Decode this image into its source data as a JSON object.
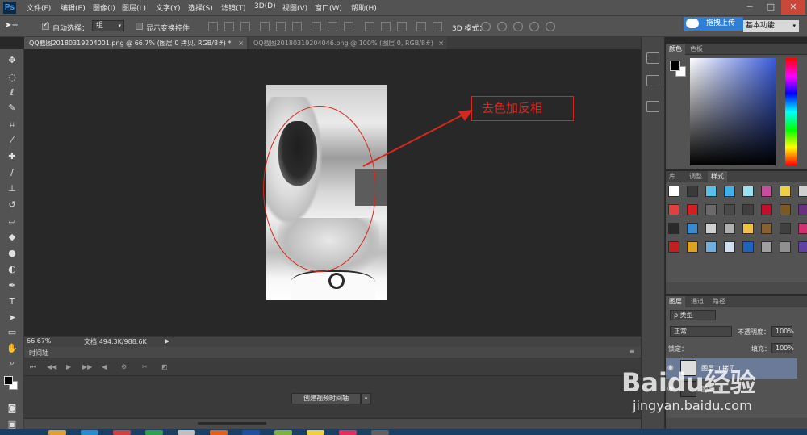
{
  "app": {
    "logo": "Ps"
  },
  "menu": [
    "文件(F)",
    "编辑(E)",
    "图像(I)",
    "图层(L)",
    "文字(Y)",
    "选择(S)",
    "滤镜(T)",
    "3D(D)",
    "视图(V)",
    "窗口(W)",
    "帮助(H)"
  ],
  "window_controls": {
    "minimize": "─",
    "maximize": "□",
    "close": "✕"
  },
  "options_bar": {
    "auto_select_label": "自动选择：",
    "auto_select_value": "组",
    "show_transform_label": "显示变换控件",
    "mode_3d_label": "3D 模式：",
    "upload_label": "拖拽上传",
    "workspace": "基本功能"
  },
  "tabs": [
    {
      "title": "QQ截图20180319204001.png @ 66.7% (图层 0 拷贝, RGB/8#) *",
      "close": "×"
    },
    {
      "title": "QQ截图20180319204046.png @ 100% (图层 0, RGB/8#)",
      "close": "×"
    }
  ],
  "canvas": {
    "annotation": "去色加反相"
  },
  "status": {
    "zoom": "66.67%",
    "doc_info": "文档:494.3K/988.6K"
  },
  "timeline": {
    "title": "时间轴",
    "create_button": "创建视频时间轴"
  },
  "color_panel": {
    "tabs": [
      "颜色",
      "色板"
    ]
  },
  "styles_panel": {
    "tabs": [
      "库",
      "调整",
      "样式"
    ],
    "active": "样式"
  },
  "layers_panel": {
    "tabs": [
      "图层",
      "通道",
      "路径"
    ],
    "filter_kind": "ρ 类型",
    "blend_mode": "正常",
    "opacity_label": "不透明度：",
    "opacity_value": "100%",
    "lock_label": "锁定：",
    "fill_label": "填充：",
    "fill_value": "100%",
    "layers": [
      {
        "name": "图层 0 拷贝",
        "selected": true
      },
      {
        "name": "图层 0",
        "selected": false
      }
    ]
  },
  "watermark": {
    "brand": "Baidu经验",
    "url": "jingyan.baidu.com"
  }
}
